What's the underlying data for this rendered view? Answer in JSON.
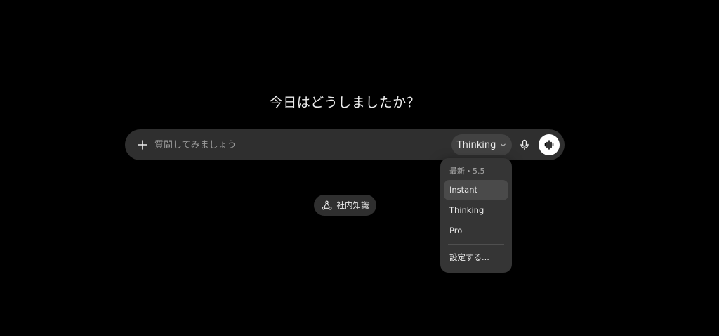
{
  "main": {
    "headline": "今日はどうしましたか？"
  },
  "composer": {
    "placeholder": "質問してみましょう",
    "value": "",
    "model_selector_label": "Thinking",
    "icons": {
      "add": "plus-icon",
      "model_dropdown": "chevron-down-icon",
      "mic": "microphone-icon",
      "voice": "voice-waveform-icon"
    }
  },
  "model_menu": {
    "header": "最新・5.5",
    "items": [
      {
        "label": "Instant",
        "highlighted": true
      },
      {
        "label": "Thinking",
        "highlighted": false
      },
      {
        "label": "Pro",
        "highlighted": false
      }
    ],
    "settings_label": "設定する..."
  },
  "knowledge_chip": {
    "label": "社内知識",
    "icon": "connected-nodes-icon"
  },
  "colors": {
    "background": "#000000",
    "composer_bg": "#2f2f2f",
    "menu_bg": "#353535",
    "menu_highlight": "#4a4a4a",
    "text": "#ececec",
    "muted_text": "#9b9b9b"
  }
}
